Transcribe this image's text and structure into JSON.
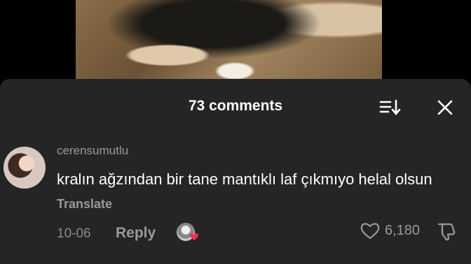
{
  "header": {
    "title": "73 comments",
    "sort_icon": "sort-icon",
    "close_icon": "close-icon"
  },
  "comment": {
    "username": "cerensumutlu",
    "text": "kralın ağzından bir tane mantıklı laf çıkmıyo helal olsun",
    "translate_label": "Translate",
    "date": "10-06",
    "reply_label": "Reply",
    "like_count": "6,180"
  },
  "colors": {
    "sheet_background": "#252525",
    "secondary_text": "#9a9a9a",
    "heart_badge": "#fe2c55"
  }
}
